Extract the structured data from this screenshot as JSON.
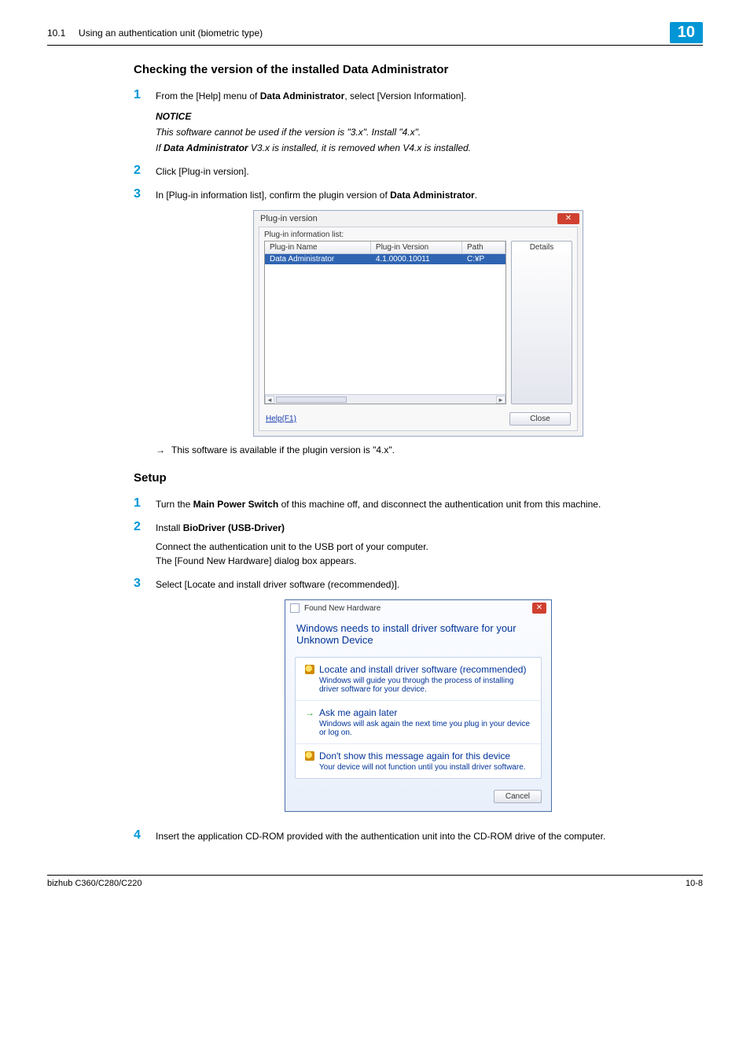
{
  "header": {
    "section_ref": "10.1",
    "section_title": "Using an authentication unit (biometric type)",
    "chapter": "10"
  },
  "check_section": {
    "heading": "Checking the version of the installed Data Administrator",
    "steps": {
      "1": {
        "text_a": "From the [Help] menu of ",
        "text_b": "Data Administrator",
        "text_c": ", select [Version Information].",
        "notice_label": "NOTICE",
        "notice_line1": "This software cannot be used if the version is \"3.x\". Install \"4.x\".",
        "notice_line2_a": "If ",
        "notice_line2_b": "Data Administrator",
        "notice_line2_c": " V3.x is installed, it is removed when V4.x is installed."
      },
      "2": "Click [Plug-in version].",
      "3_a": "In [Plug-in information list], confirm the plugin version of ",
      "3_b": "Data Administrator",
      "3_c": "."
    },
    "dialog": {
      "title": "Plug-in version",
      "list_label": "Plug-in information list:",
      "columns": {
        "name": "Plug-in Name",
        "version": "Plug-in Version",
        "path": "Path"
      },
      "row": {
        "name": "Data Administrator",
        "version": "4.1.0000.10011",
        "path": "C:¥P"
      },
      "details_btn": "Details",
      "help_link": "Help(F1)",
      "close_btn": "Close"
    },
    "arrow_note": "This software is available if the plugin version is \"4.x\"."
  },
  "setup_section": {
    "heading": "Setup",
    "steps": {
      "1_a": "Turn the ",
      "1_b": "Main Power Switch",
      "1_c": " of this machine off, and disconnect the authentication unit from this machine.",
      "2_a": "Install ",
      "2_b": "BioDriver (USB-Driver)",
      "2_l2": "Connect the authentication unit to the USB port of your computer.",
      "2_l3": "The [Found New Hardware] dialog box appears.",
      "3": "Select [Locate and install driver software (recommended)].",
      "4": "Insert the application CD-ROM provided with the authentication unit into the CD-ROM drive of the computer."
    },
    "dialog": {
      "title": "Found New Hardware",
      "heading": "Windows needs to install driver software for your Unknown Device",
      "opt1_t": "Locate and install driver software (recommended)",
      "opt1_s": "Windows will guide you through the process of installing driver software for your device.",
      "opt2_t": "Ask me again later",
      "opt2_s": "Windows will ask again the next time you plug in your device or log on.",
      "opt3_t": "Don't show this message again for this device",
      "opt3_s": "Your device will not function until you install driver software.",
      "cancel": "Cancel"
    }
  },
  "footer": {
    "product": "bizhub C360/C280/C220",
    "page": "10-8"
  }
}
